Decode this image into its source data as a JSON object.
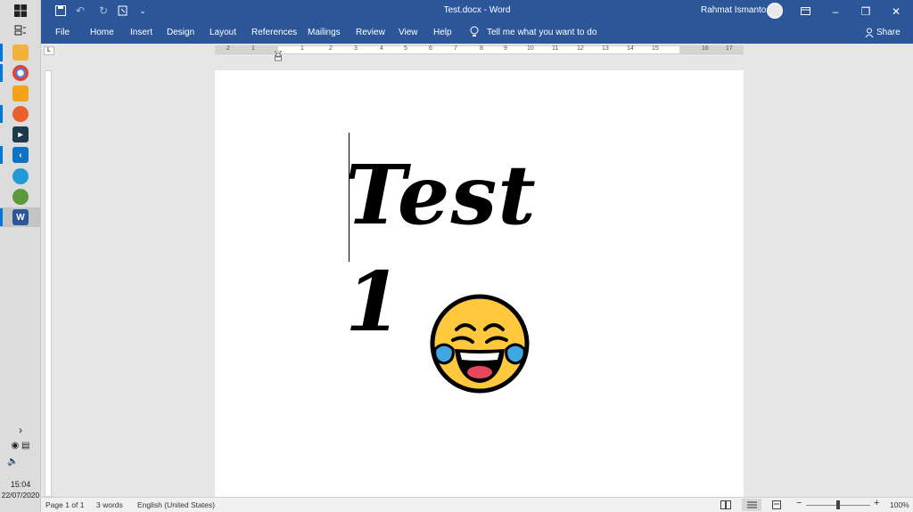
{
  "window": {
    "title": "Test.docx - Word",
    "user_name": "Rahmat Ismanto"
  },
  "ribbon": {
    "tabs": [
      "File",
      "Home",
      "Insert",
      "Design",
      "Layout",
      "References",
      "Mailings",
      "Review",
      "View",
      "Help"
    ],
    "tell_me": "Tell me what you want to do",
    "share": "Share"
  },
  "ruler": {
    "numbers": [
      "2",
      "1",
      "1",
      "2",
      "3",
      "4",
      "5",
      "6",
      "7",
      "8",
      "9",
      "10",
      "11",
      "12",
      "13",
      "14",
      "15",
      "16",
      "17",
      "18"
    ]
  },
  "document": {
    "heading": "Test 1",
    "emoji": "face-with-tears-of-joy"
  },
  "status": {
    "page": "Page 1 of 1",
    "words": "3 words",
    "language": "English (United States)",
    "zoom": "100%"
  },
  "system": {
    "time": "15:04",
    "date": "22/07/2020"
  },
  "colors": {
    "word_blue": "#2b579a",
    "accent": "#0078d7"
  }
}
